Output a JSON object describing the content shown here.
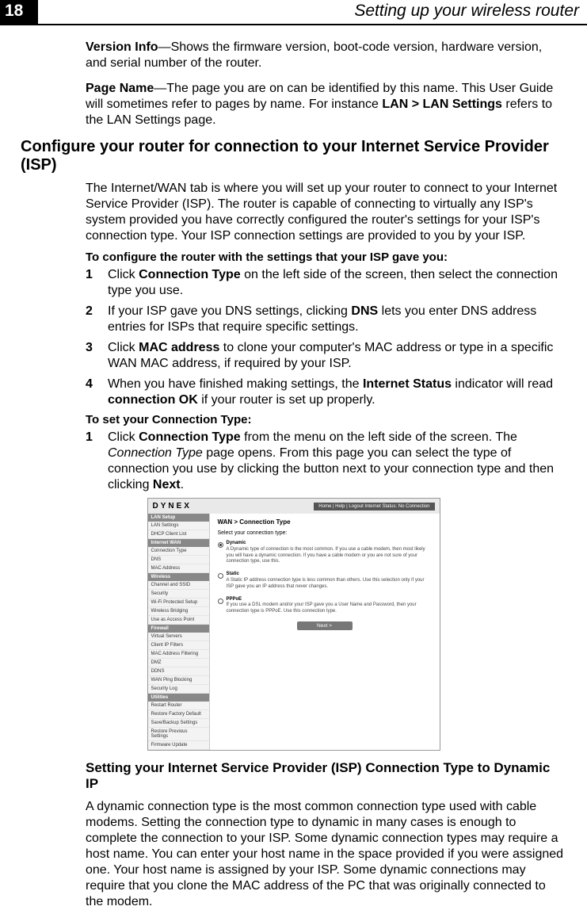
{
  "header": {
    "page_number": "18",
    "chapter_title": "Setting up your wireless router"
  },
  "paragraphs": {
    "version_info_label": "Version Info",
    "version_info_text": "—Shows the firmware version, boot-code version, hardware version, and serial number of the router.",
    "page_name_label": "Page Name",
    "page_name_text_a": "—The page you are on can be identified by this name. This User Guide will sometimes refer to pages by name. For instance ",
    "page_name_bold": "LAN > LAN Settings",
    "page_name_text_b": " refers to the LAN Settings page."
  },
  "section_heading": "Configure your router for connection to your Internet Service Provider (ISP)",
  "intro": {
    "a": "The ",
    "b": "Internet/WAN",
    "c": " tab is where you will set up your router to connect to your Internet Service Provider (ISP). The router is capable of connecting to virtually any ISP's system provided you have correctly configured the router's settings for your ISP's connection type. Your ISP connection settings are provided to you by your ISP."
  },
  "proc1": {
    "heading": "To configure the router with the settings that your ISP gave you:",
    "steps": [
      {
        "num": "1",
        "pre": "Click ",
        "bold1": "Connection Type",
        "post": " on the left side of the screen, then select the connection type you use."
      },
      {
        "num": "2",
        "pre": "If your ISP gave you DNS settings, clicking ",
        "bold1": "DNS",
        "post": " lets you enter DNS address entries for ISPs that require specific settings."
      },
      {
        "num": "3",
        "pre": "Click ",
        "bold1": "MAC address",
        "post": " to clone your computer's MAC address or type in a specific WAN MAC address, if required by your ISP."
      },
      {
        "num": "4",
        "pre": "When you have finished making settings, the ",
        "bold1": "Internet Status",
        "mid": " indicator will read ",
        "bold2": "connection OK",
        "post": " if your router is set up properly."
      }
    ]
  },
  "proc2": {
    "heading": "To set your Connection Type:",
    "step": {
      "num": "1",
      "pre": "Click ",
      "bold1": "Connection Type",
      "mid1": " from the menu on the left side of the screen. The ",
      "ital": "Connection Type",
      "mid2": " page opens. From this page you can select the type of connection you use by clicking the button next to your connection type and then clicking ",
      "bold2": "Next",
      "post": "."
    }
  },
  "screenshot": {
    "logo": "DYNEX",
    "toplinks": "Home | Help | Logout   Internet Status:",
    "topstatus": "No Connection",
    "menu": {
      "cat1": "LAN Setup",
      "items1": [
        "LAN Settings",
        "DHCP Client List"
      ],
      "cat2": "Internet WAN",
      "items2": [
        "Connection Type",
        "DNS",
        "MAC Address"
      ],
      "cat3": "Wireless",
      "items3": [
        "Channel and SSID",
        "Security",
        "Wi-Fi Protected Setup",
        "Wireless Bridging",
        "Use as Access Point"
      ],
      "cat4": "Firewall",
      "items4": [
        "Virtual Servers",
        "Client IP Filters",
        "MAC Address Filtering",
        "DMZ",
        "DDNS",
        "WAN Ping Blocking",
        "Security Log"
      ],
      "cat5": "Utilities",
      "items5": [
        "Restart Router",
        "Restore Factory Default",
        "Save/Backup Settings",
        "Restore Previous Settings",
        "Firmware Update"
      ]
    },
    "main": {
      "crumb": "WAN > Connection Type",
      "select_label": "Select your connection type:",
      "opts": [
        {
          "title": "Dynamic",
          "desc": "A Dynamic type of connection is the most common. If you use a cable modem, then most likely you will have a dynamic connection. If you have a cable modem or you are not sure of your connection type, use this."
        },
        {
          "title": "Static",
          "desc": "A Static IP address connection type is less common than others. Use this selection only if your ISP gave you an IP address that never changes."
        },
        {
          "title": "PPPoE",
          "desc": "If you use a DSL modem and/or your ISP gave you a User Name and Password, then your connection type is PPPoE. Use this connection type."
        }
      ],
      "next": "Next >"
    }
  },
  "sub_heading": "Setting your Internet Service Provider (ISP) Connection Type to Dynamic IP",
  "closing": {
    "a": "A dynamic connection type is the most common connection type used with cable modems. Setting the connection type to ",
    "b": "dynamic",
    "c": " in many cases is enough to complete the connection to your ISP. Some dynamic connection types may require a host name. You can enter your host name in the space provided if you were assigned one. Your host name is assigned by your ISP. Some dynamic connections may require that you clone the MAC address of the PC that was originally connected to the modem."
  }
}
